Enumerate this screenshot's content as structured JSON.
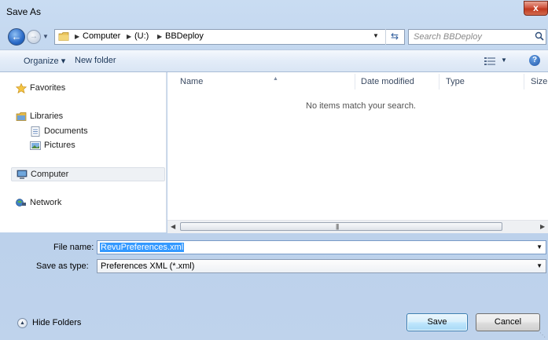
{
  "window": {
    "title": "Save As",
    "close_label": "x"
  },
  "nav": {
    "breadcrumbs": [
      "Computer",
      "(U:)",
      "BBDeploy"
    ],
    "search_placeholder": "Search BBDeploy"
  },
  "toolbar": {
    "organize_label": "Organize ▾",
    "new_folder_label": "New folder",
    "help_label": "?"
  },
  "sidebar": {
    "items": [
      {
        "label": "Favorites",
        "icon": "star-icon"
      },
      {
        "label": "Libraries",
        "icon": "libraries-icon"
      },
      {
        "label": "Documents",
        "icon": "documents-icon"
      },
      {
        "label": "Pictures",
        "icon": "pictures-icon"
      },
      {
        "label": "Computer",
        "icon": "computer-icon"
      },
      {
        "label": "Network",
        "icon": "network-icon"
      }
    ]
  },
  "filelist": {
    "columns": [
      "Name",
      "Date modified",
      "Type",
      "Size"
    ],
    "empty_message": "No items match your search."
  },
  "form": {
    "filename_label": "File name:",
    "filename_value": "RevuPreferences.xml",
    "type_label": "Save as type:",
    "type_value": "Preferences XML (*.xml)"
  },
  "footer": {
    "hide_folders_label": "Hide Folders",
    "save_label": "Save",
    "cancel_label": "Cancel"
  },
  "colors": {
    "accent": "#3399ff",
    "window_frame": "#c9dcf2",
    "close": "#c0391f"
  }
}
